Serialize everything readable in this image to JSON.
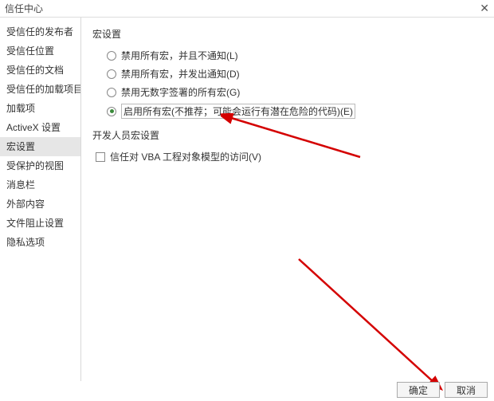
{
  "titlebar": {
    "title": "信任中心",
    "close": "✕"
  },
  "sidebar": {
    "items": [
      {
        "label": "受信任的发布者"
      },
      {
        "label": "受信任位置"
      },
      {
        "label": "受信任的文档"
      },
      {
        "label": "受信任的加载项目录"
      },
      {
        "label": "加载项"
      },
      {
        "label": "ActiveX 设置"
      },
      {
        "label": "宏设置"
      },
      {
        "label": "受保护的视图"
      },
      {
        "label": "消息栏"
      },
      {
        "label": "外部内容"
      },
      {
        "label": "文件阻止设置"
      },
      {
        "label": "隐私选项"
      }
    ],
    "selected_index": 6
  },
  "main": {
    "section1_title": "宏设置",
    "radios": [
      {
        "label": "禁用所有宏，并且不通知(L)"
      },
      {
        "label": "禁用所有宏，并发出通知(D)"
      },
      {
        "label": "禁用无数字签署的所有宏(G)"
      },
      {
        "label": "启用所有宏(不推荐；可能会运行有潜在危险的代码)(E)"
      }
    ],
    "selected_radio": 3,
    "section2_title": "开发人员宏设置",
    "checkbox_label": "信任对 VBA 工程对象模型的访问(V)"
  },
  "footer": {
    "ok": "确定",
    "cancel": "取消"
  }
}
